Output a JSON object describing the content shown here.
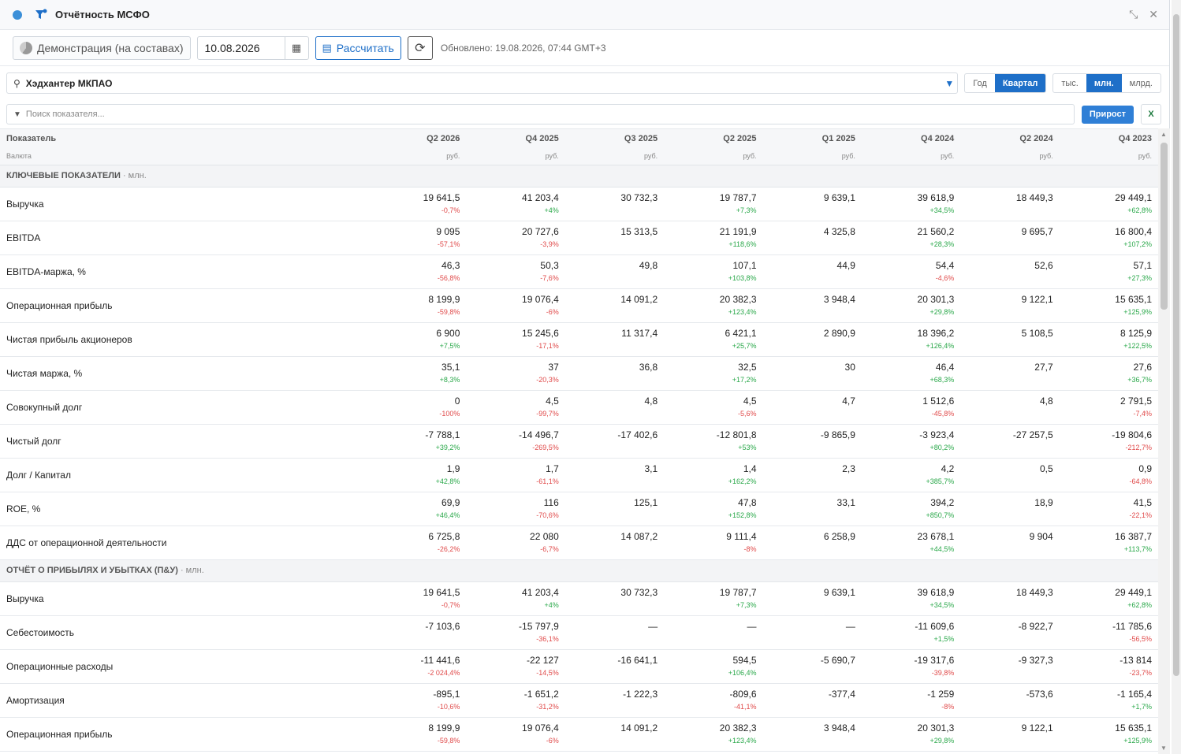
{
  "title": "Отчётность МСФО",
  "toolbar": {
    "portfolio": "Демонстрация (на составах)",
    "date": "10.08.2026",
    "calc_label": "Рассчитать",
    "updated": "Обновлено: 19.08.2026, 07:44 GMT+3"
  },
  "company": "Хэдхантер МКПАО",
  "period_options": [
    "Год",
    "Квартал"
  ],
  "period_active": "Квартал",
  "unit_options": [
    "тыс.",
    "млн.",
    "млрд."
  ],
  "unit_active": "млн.",
  "search_placeholder": "Поиск показателя...",
  "growth_label": "Прирост",
  "excel_label": "X",
  "table": {
    "header_label": "Показатель",
    "currency_label": "Валюта",
    "periods": [
      "Q2 2026",
      "Q4 2025",
      "Q3 2025",
      "Q2 2025",
      "Q1 2025",
      "Q4 2024",
      "Q2 2024",
      "Q4 2023"
    ],
    "currency": "руб.",
    "sections": [
      {
        "title": "КЛЮЧЕВЫЕ ПОКАЗАТЕЛИ",
        "unit": "· млн.",
        "rows": [
          {
            "name": "Выручка",
            "values": [
              "19 641,5",
              "41 203,4",
              "30 732,3",
              "19 787,7",
              "9 639,1",
              "39 618,9",
              "18 449,3",
              "29 449,1"
            ],
            "changes": [
              "-0,7%",
              "+4%",
              "",
              "+7,3%",
              "",
              "+34,5%",
              "",
              "+62,8%"
            ]
          },
          {
            "name": "EBITDA",
            "values": [
              "9 095",
              "20 727,6",
              "15 313,5",
              "21 191,9",
              "4 325,8",
              "21 560,2",
              "9 695,7",
              "16 800,4"
            ],
            "changes": [
              "-57,1%",
              "-3,9%",
              "",
              "+118,6%",
              "",
              "+28,3%",
              "",
              "+107,2%"
            ]
          },
          {
            "name": "EBITDA-маржа, %",
            "values": [
              "46,3",
              "50,3",
              "49,8",
              "107,1",
              "44,9",
              "54,4",
              "52,6",
              "57,1"
            ],
            "changes": [
              "-56,8%",
              "-7,6%",
              "",
              "+103,8%",
              "",
              "-4,6%",
              "",
              "+27,3%"
            ]
          },
          {
            "name": "Операционная прибыль",
            "values": [
              "8 199,9",
              "19 076,4",
              "14 091,2",
              "20 382,3",
              "3 948,4",
              "20 301,3",
              "9 122,1",
              "15 635,1"
            ],
            "changes": [
              "-59,8%",
              "-6%",
              "",
              "+123,4%",
              "",
              "+29,8%",
              "",
              "+125,9%"
            ]
          },
          {
            "name": "Чистая прибыль акционеров",
            "values": [
              "6 900",
              "15 245,6",
              "11 317,4",
              "6 421,1",
              "2 890,9",
              "18 396,2",
              "5 108,5",
              "8 125,9"
            ],
            "changes": [
              "+7,5%",
              "-17,1%",
              "",
              "+25,7%",
              "",
              "+126,4%",
              "",
              "+122,5%"
            ]
          },
          {
            "name": "Чистая маржа, %",
            "values": [
              "35,1",
              "37",
              "36,8",
              "32,5",
              "30",
              "46,4",
              "27,7",
              "27,6"
            ],
            "changes": [
              "+8,3%",
              "-20,3%",
              "",
              "+17,2%",
              "",
              "+68,3%",
              "",
              "+36,7%"
            ]
          },
          {
            "name": "Совокупный долг",
            "values": [
              "0",
              "4,5",
              "4,8",
              "4,5",
              "4,7",
              "1 512,6",
              "4,8",
              "2 791,5"
            ],
            "changes": [
              "-100%",
              "-99,7%",
              "",
              "-5,6%",
              "",
              "-45,8%",
              "",
              "-7,4%"
            ]
          },
          {
            "name": "Чистый долг",
            "values": [
              "-7 788,1",
              "-14 496,7",
              "-17 402,6",
              "-12 801,8",
              "-9 865,9",
              "-3 923,4",
              "-27 257,5",
              "-19 804,6"
            ],
            "changes": [
              "+39,2%",
              "-269,5%",
              "",
              "+53%",
              "",
              "+80,2%",
              "",
              "-212,7%"
            ]
          },
          {
            "name": "Долг / Капитал",
            "values": [
              "1,9",
              "1,7",
              "3,1",
              "1,4",
              "2,3",
              "4,2",
              "0,5",
              "0,9"
            ],
            "changes": [
              "+42,8%",
              "-61,1%",
              "",
              "+162,2%",
              "",
              "+385,7%",
              "",
              "-64,8%"
            ]
          },
          {
            "name": "ROE, %",
            "values": [
              "69,9",
              "116",
              "125,1",
              "47,8",
              "33,1",
              "394,2",
              "18,9",
              "41,5"
            ],
            "changes": [
              "+46,4%",
              "-70,6%",
              "",
              "+152,8%",
              "",
              "+850,7%",
              "",
              "-22,1%"
            ]
          },
          {
            "name": "ДДС от операционной деятельности",
            "values": [
              "6 725,8",
              "22 080",
              "14 087,2",
              "9 111,4",
              "6 258,9",
              "23 678,1",
              "9 904",
              "16 387,7"
            ],
            "changes": [
              "-26,2%",
              "-6,7%",
              "",
              "-8%",
              "",
              "+44,5%",
              "",
              "+113,7%"
            ]
          }
        ]
      },
      {
        "title": "ОТЧЁТ О ПРИБЫЛЯХ И УБЫТКАХ (П&У)",
        "unit": "· млн.",
        "rows": [
          {
            "name": "Выручка",
            "values": [
              "19 641,5",
              "41 203,4",
              "30 732,3",
              "19 787,7",
              "9 639,1",
              "39 618,9",
              "18 449,3",
              "29 449,1"
            ],
            "changes": [
              "-0,7%",
              "+4%",
              "",
              "+7,3%",
              "",
              "+34,5%",
              "",
              "+62,8%"
            ]
          },
          {
            "name": "Себестоимость",
            "values": [
              "-7 103,6",
              "-15 797,9",
              "—",
              "—",
              "—",
              "-11 609,6",
              "-8 922,7",
              "-11 785,6"
            ],
            "changes": [
              "",
              "-36,1%",
              "",
              "",
              "",
              "+1,5%",
              "",
              "-56,5%"
            ]
          },
          {
            "name": "Операционные расходы",
            "values": [
              "-11 441,6",
              "-22 127",
              "-16 641,1",
              "594,5",
              "-5 690,7",
              "-19 317,6",
              "-9 327,3",
              "-13 814"
            ],
            "changes": [
              "-2 024,4%",
              "-14,5%",
              "",
              "+106,4%",
              "",
              "-39,8%",
              "",
              "-23,7%"
            ]
          },
          {
            "name": "Амортизация",
            "values": [
              "-895,1",
              "-1 651,2",
              "-1 222,3",
              "-809,6",
              "-377,4",
              "-1 259",
              "-573,6",
              "-1 165,4"
            ],
            "changes": [
              "-10,6%",
              "-31,2%",
              "",
              "-41,1%",
              "",
              "-8%",
              "",
              "+1,7%"
            ]
          },
          {
            "name": "Операционная прибыль",
            "values": [
              "8 199,9",
              "19 076,4",
              "14 091,2",
              "20 382,3",
              "3 948,4",
              "20 301,3",
              "9 122,1",
              "15 635,1"
            ],
            "changes": [
              "-59,8%",
              "-6%",
              "",
              "+123,4%",
              "",
              "+29,8%",
              "",
              "+125,9%"
            ]
          }
        ]
      }
    ]
  }
}
